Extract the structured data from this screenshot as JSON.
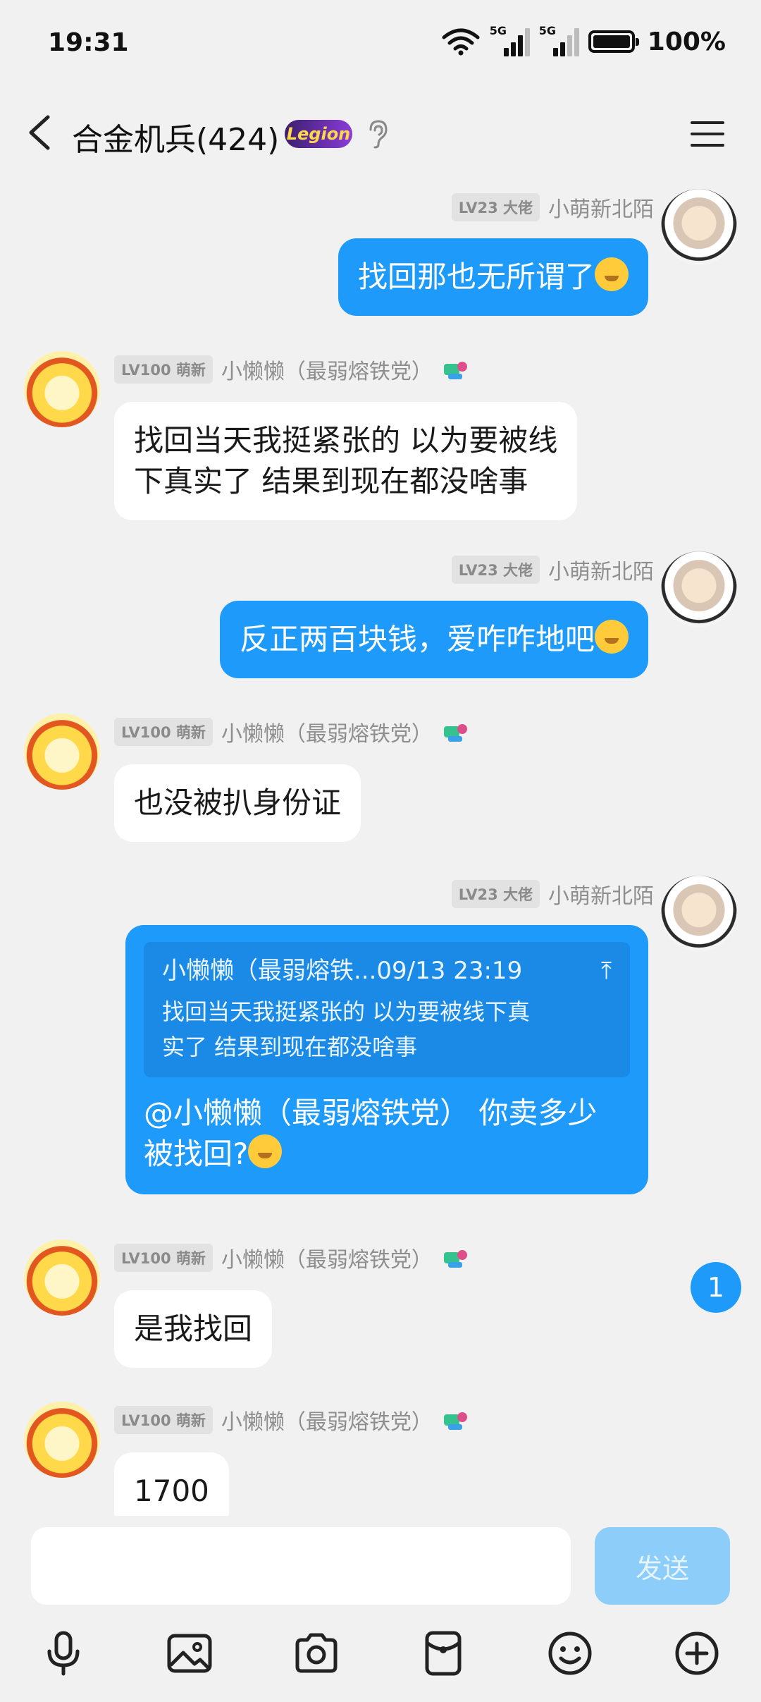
{
  "status_bar": {
    "time": "19:31",
    "signal_label_1": "5G",
    "signal_label_2": "5G",
    "battery_percent": "100%"
  },
  "header": {
    "title": "合金机兵(424)",
    "badge_text": "Legion"
  },
  "messages": [
    {
      "sender": "me",
      "level": "LV23 大佬",
      "name": "小萌新北陌",
      "text": "找回那也无所谓了"
    },
    {
      "sender": "other",
      "level": "LV100 萌新",
      "name": "小懒懒（最弱熔铁党）",
      "text_line1": "找回当天我挺紧张的 以为要被线",
      "text_line2": "下真实了 结果到现在都没啥事"
    },
    {
      "sender": "me",
      "level": "LV23 大佬",
      "name": "小萌新北陌",
      "text": "反正两百块钱，爱咋咋地吧"
    },
    {
      "sender": "other",
      "level": "LV100 萌新",
      "name": "小懒懒（最弱熔铁党）",
      "text": "也没被扒身份证"
    },
    {
      "sender": "me",
      "level": "LV23 大佬",
      "name": "小萌新北陌",
      "quote_header": "小懒懒（最弱熔铁...09/13 23:19",
      "quote_arrow": "⤒",
      "quote_line1": "找回当天我挺紧张的 以为要被线下真",
      "quote_line2": "实了 结果到现在都没啥事",
      "text_line1": "@小懒懒（最弱熔铁党） 你卖多少",
      "text_line2": "被找回?"
    },
    {
      "sender": "other",
      "level": "LV100 萌新",
      "name": "小懒懒（最弱熔铁党）",
      "text": "是我找回"
    },
    {
      "sender": "other",
      "level": "LV100 萌新",
      "name": "小懒懒（最弱熔铁党）",
      "text": "1700"
    }
  ],
  "unread_count": "1",
  "input": {
    "placeholder": "",
    "send_label": "发送"
  },
  "toolbar": [
    "microphone-icon",
    "image-icon",
    "camera-icon",
    "red-packet-icon",
    "emoji-icon",
    "plus-icon"
  ],
  "colors": {
    "accent": "#1e9bfa",
    "background": "#f1f1f1",
    "send_disabled": "#8ccdfa"
  }
}
